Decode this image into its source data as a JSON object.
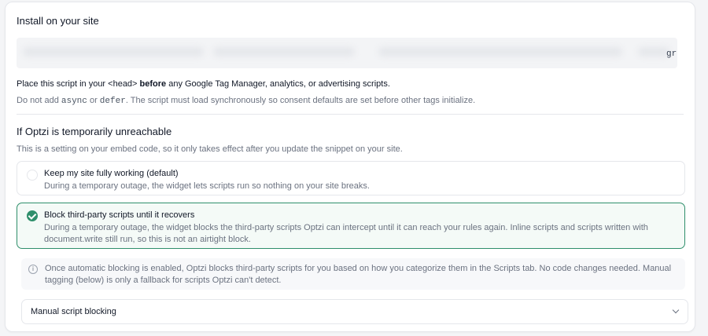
{
  "section": {
    "title": "Install on your site",
    "snippet_tail": "gr"
  },
  "instructions": {
    "place_prefix": "Place this script in your <head> ",
    "place_bold": "before",
    "place_suffix": " any Google Tag Manager, analytics, or advertising scripts.",
    "note_prefix": "Do not add ",
    "note_code1": "async",
    "note_mid": " or ",
    "note_code2": "defer",
    "note_suffix": ". The script must load synchronously so consent defaults are set before other tags initialize."
  },
  "unreachable": {
    "title": "If Optzi is temporarily unreachable",
    "subtitle": "This is a setting on your embed code, so it only takes effect after you update the snippet on your site.",
    "options": [
      {
        "title": "Keep my site fully working (default)",
        "description": "During a temporary outage, the widget lets scripts run so nothing on your site breaks.",
        "selected": false
      },
      {
        "title": "Block third-party scripts until it recovers",
        "description": "During a temporary outage, the widget blocks the third-party scripts Optzi can intercept until it can reach your rules again. Inline scripts and scripts written with document.write still run, so this is not an airtight block.",
        "selected": true
      }
    ]
  },
  "info": {
    "icon": "info-icon",
    "text": "Once automatic blocking is enabled, Optzi blocks third-party scripts for you based on how you categorize them in the Scripts tab. No code changes needed. Manual tagging (below) is only a fallback for scripts Optzi can't detect."
  },
  "accordion": {
    "label": "Manual script blocking",
    "icon": "chevron-down-icon"
  },
  "colors": {
    "accent": "#2f8f6b",
    "selected_bg": "#f4faf7",
    "border": "#e5e7eb",
    "muted_text": "#6b7280"
  }
}
